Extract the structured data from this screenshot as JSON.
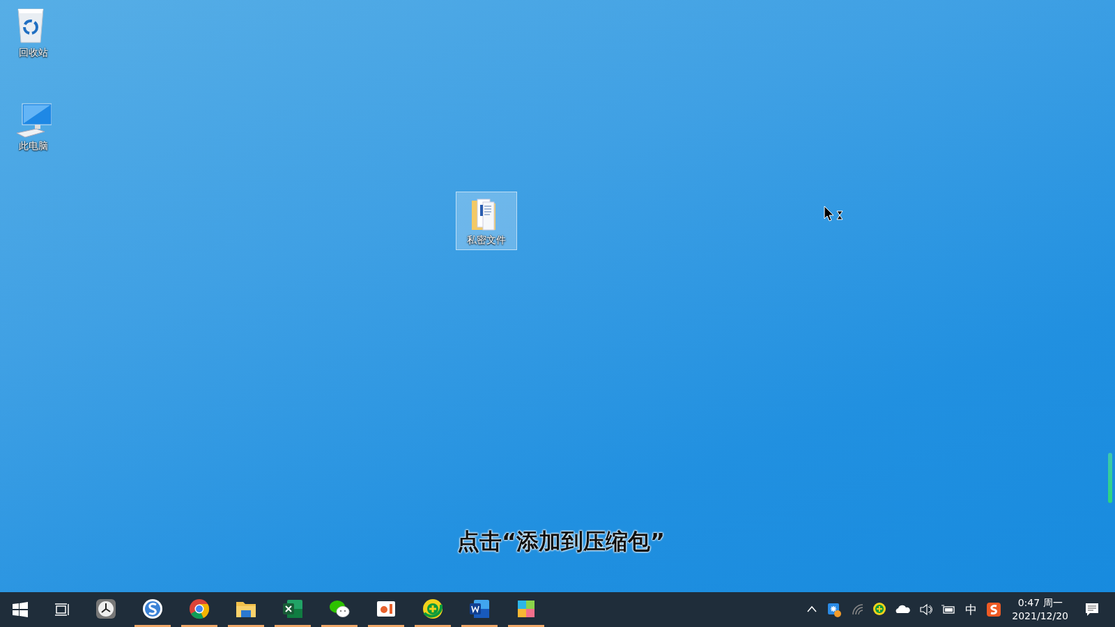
{
  "desktop_icons": [
    {
      "label": "回收站",
      "kind": "recycle",
      "selected": false
    },
    {
      "label": "此电脑",
      "kind": "computer",
      "selected": false
    },
    {
      "label": "私密文件",
      "kind": "folder",
      "selected": true
    }
  ],
  "subtitle": "点击“添加到压缩包”",
  "taskbar": {
    "apps": [
      {
        "kind": "clock",
        "running": false
      },
      {
        "kind": "sogou",
        "running": true
      },
      {
        "kind": "chrome",
        "running": true
      },
      {
        "kind": "explorer",
        "running": true
      },
      {
        "kind": "excel",
        "running": true
      },
      {
        "kind": "wechat",
        "running": true
      },
      {
        "kind": "slides",
        "running": true
      },
      {
        "kind": "plus",
        "running": true
      },
      {
        "kind": "word",
        "running": true
      },
      {
        "kind": "tiles",
        "running": true
      }
    ],
    "tray": {
      "ime": "中",
      "time": "0:47 周一",
      "date": "2021/12/20"
    }
  }
}
